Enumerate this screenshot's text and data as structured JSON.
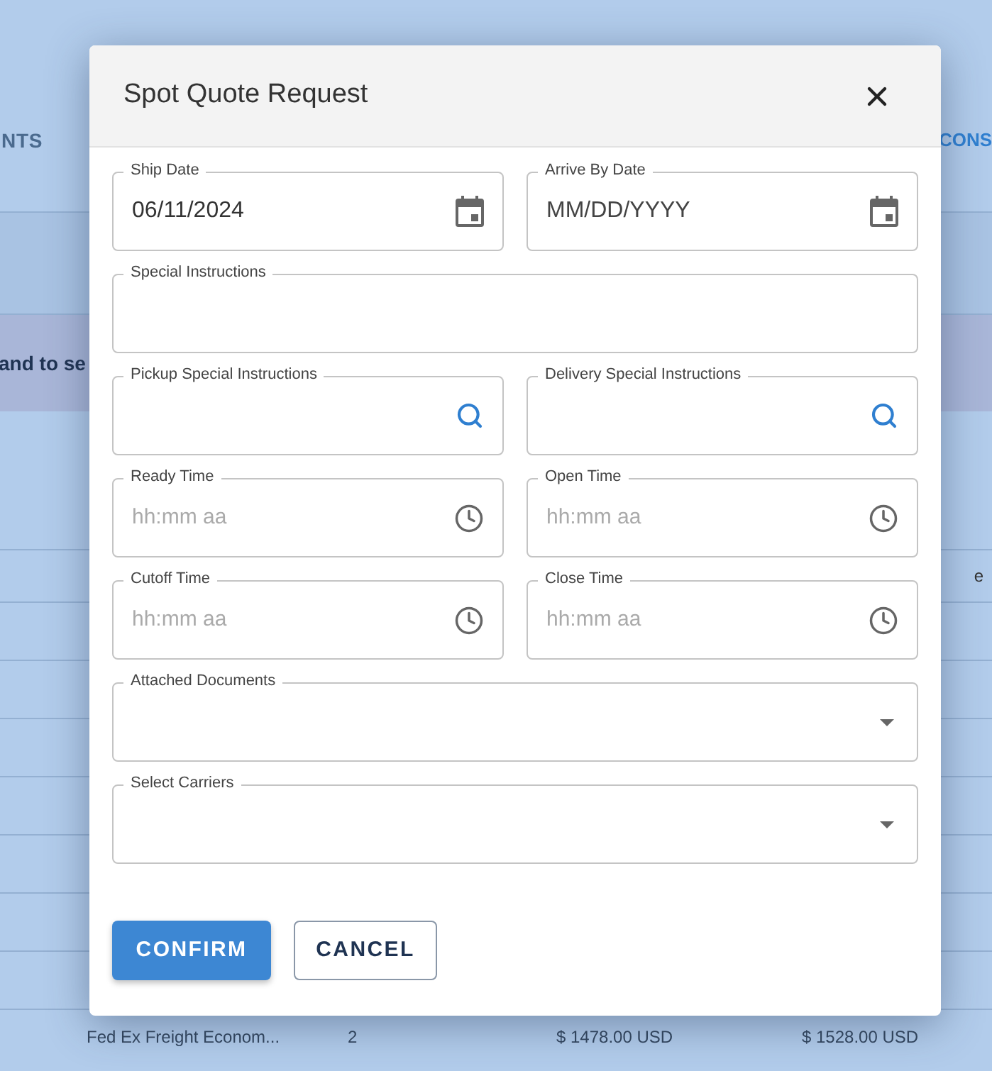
{
  "background": {
    "header_left": "NTS",
    "header_right": "CONS",
    "banner": "and to se",
    "row_fragment": "e",
    "last_row": [
      "Fed Ex Freight Econom...",
      "2",
      "$ 1478.00 USD",
      "$ 1528.00 USD"
    ]
  },
  "dialog": {
    "title": "Spot Quote Request",
    "rows": [
      [
        {
          "kind": "date",
          "label": "Ship Date",
          "value": "06/11/2024"
        },
        {
          "kind": "date",
          "label": "Arrive By Date",
          "placeholder": "MM/DD/YYYY"
        }
      ],
      [
        {
          "kind": "text",
          "label": "Special Instructions"
        }
      ],
      [
        {
          "kind": "search",
          "label": "Pickup Special Instructions"
        },
        {
          "kind": "search",
          "label": "Delivery Special Instructions"
        }
      ],
      [
        {
          "kind": "time",
          "label": "Ready Time",
          "placeholder": "hh:mm aa"
        },
        {
          "kind": "time",
          "label": "Open Time",
          "placeholder": "hh:mm aa"
        }
      ],
      [
        {
          "kind": "time",
          "label": "Cutoff Time",
          "placeholder": "hh:mm aa"
        },
        {
          "kind": "time",
          "label": "Close Time",
          "placeholder": "hh:mm aa"
        }
      ],
      [
        {
          "kind": "select",
          "label": "Attached Documents"
        }
      ],
      [
        {
          "kind": "select",
          "label": "Select Carriers"
        }
      ]
    ],
    "buttons": [
      {
        "kind": "primary",
        "label": "CONFIRM"
      },
      {
        "kind": "secondary",
        "label": "CANCEL"
      }
    ]
  }
}
